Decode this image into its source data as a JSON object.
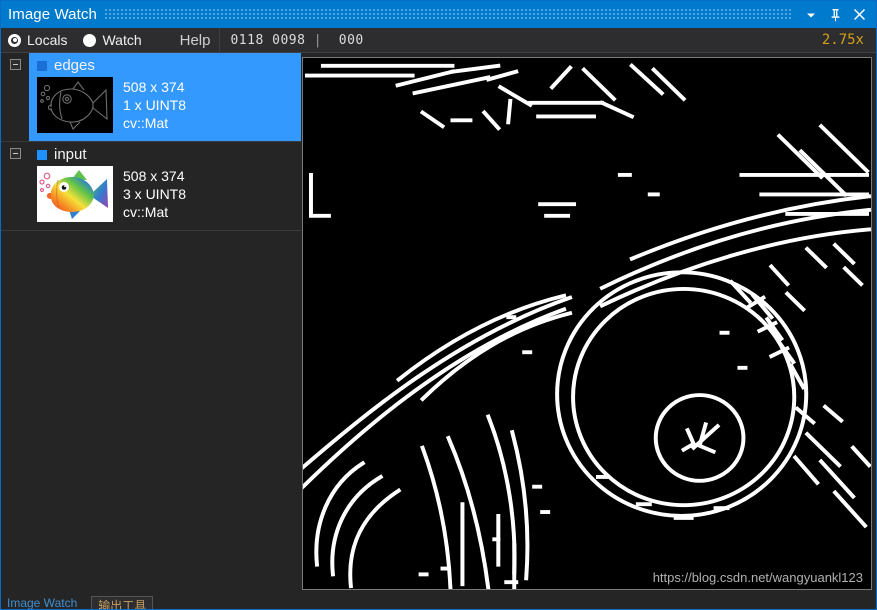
{
  "window": {
    "title": "Image Watch",
    "buttons": [
      {
        "name": "dropdown-menu-button",
        "glyph": "chevron-down"
      },
      {
        "name": "pin-button",
        "glyph": "pin"
      },
      {
        "name": "close-button",
        "glyph": "close"
      }
    ],
    "accent_color": "#007acc"
  },
  "toolbar": {
    "modes": [
      {
        "label": "Locals",
        "checked": true
      },
      {
        "label": "Watch",
        "checked": false
      }
    ],
    "help_label": "Help",
    "coords_x": "0118",
    "coords_y": "0098",
    "separator": "|",
    "pixel_value": "000",
    "zoom_level": "2.75x",
    "zoom_color": "#d4a017"
  },
  "tree": {
    "items": [
      {
        "name": "edges",
        "expanded": true,
        "selected": true,
        "dimensions": "508 x 374",
        "type": "1 x UINT8",
        "class": "cv::Mat",
        "thumbnail": "edges-thumbnail"
      },
      {
        "name": "input",
        "expanded": true,
        "selected": false,
        "dimensions": "508 x 374",
        "type": "3 x UINT8",
        "class": "cv::Mat",
        "thumbnail": "input-thumbnail"
      }
    ]
  },
  "viewport": {
    "name": "image-viewport",
    "background": "#000000",
    "foreground": "#ffffff",
    "watermark": "https://blog.csdn.net/wangyuankl123"
  },
  "bottom": {
    "tab_label": "Image Watch",
    "box_label": "输出工具"
  }
}
